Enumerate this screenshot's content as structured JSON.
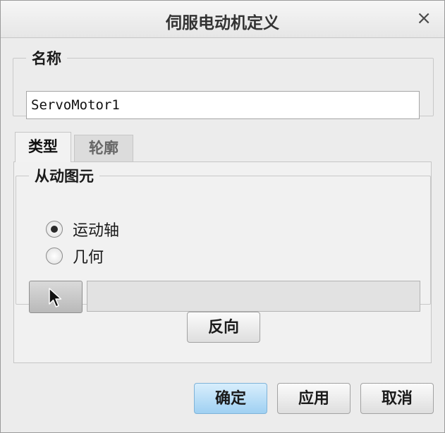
{
  "dialog": {
    "title": "伺服电动机定义",
    "close_glyph": "×"
  },
  "name_section": {
    "legend": "名称",
    "value": "ServoMotor1"
  },
  "tabs": [
    {
      "label": "类型",
      "active": true
    },
    {
      "label": "轮廓",
      "active": false
    }
  ],
  "driven_entity": {
    "legend": "从动图元",
    "options": [
      {
        "label": "运动轴",
        "checked": true
      },
      {
        "label": "几何",
        "checked": false
      }
    ],
    "select_icon": "arrow-cursor-icon",
    "selection_value": ""
  },
  "reverse_button": "反向",
  "footer": {
    "ok": "确定",
    "apply": "应用",
    "cancel": "取消"
  },
  "colors": {
    "primary_button": "#9fd0f2",
    "dialog_bg": "#ececec"
  }
}
